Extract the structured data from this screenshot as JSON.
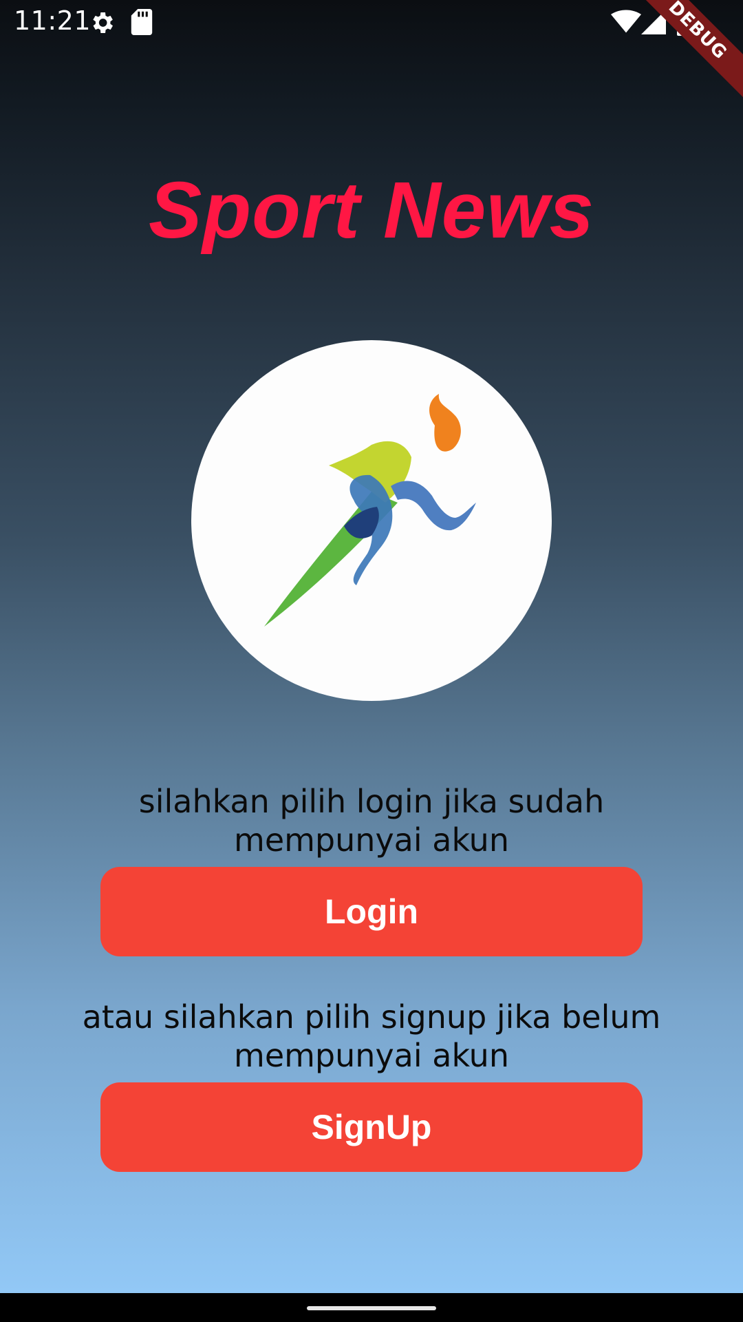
{
  "status_bar": {
    "time": "11:21",
    "icons": [
      "gear-icon",
      "sdcard-icon",
      "wifi-icon",
      "signal-icon",
      "battery-icon"
    ]
  },
  "debug_banner": "DEBUG",
  "title": "Sport News",
  "logo": {
    "icon": "running-man-logo",
    "colors": {
      "body": "#c3d530",
      "leg": "#3d78b8",
      "flame": "#f0821e",
      "tail": "#5cb640"
    }
  },
  "login_section": {
    "prompt": "silahkan pilih login jika sudah mempunyai akun",
    "button_label": "Login"
  },
  "signup_section": {
    "prompt": "atau silahkan pilih signup jika belum mempunyai akun",
    "button_label": "SignUp"
  },
  "theme": {
    "accent": "#ff1744",
    "button": "#f44336",
    "gradient_top": "#0b0e12",
    "gradient_bottom": "#92c8f6"
  }
}
